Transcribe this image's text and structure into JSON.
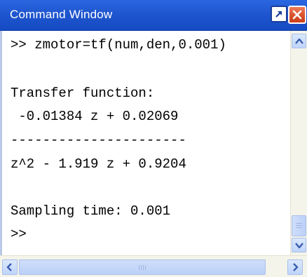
{
  "window": {
    "title": "Command Window"
  },
  "console": {
    "lines": [
      ">> zmotor=tf(num,den,0.001)",
      "",
      "Transfer function:",
      " -0.01384 z + 0.02069",
      "----------------------",
      "z^2 - 1.919 z + 0.9204",
      "",
      "Sampling time: 0.001",
      ">>"
    ]
  },
  "icons": {
    "undock": "undock-arrow-icon",
    "close": "close-x-icon",
    "scroll_up": "triangle-up-icon",
    "scroll_down": "triangle-down-icon",
    "scroll_left": "triangle-left-icon",
    "scroll_right": "triangle-right-icon"
  },
  "colors": {
    "titlebar": "#1f56cf",
    "close_button": "#d9532c",
    "scrollbar_track": "#f5f4ea",
    "scrollbar_thumb": "#c0d5fb"
  }
}
